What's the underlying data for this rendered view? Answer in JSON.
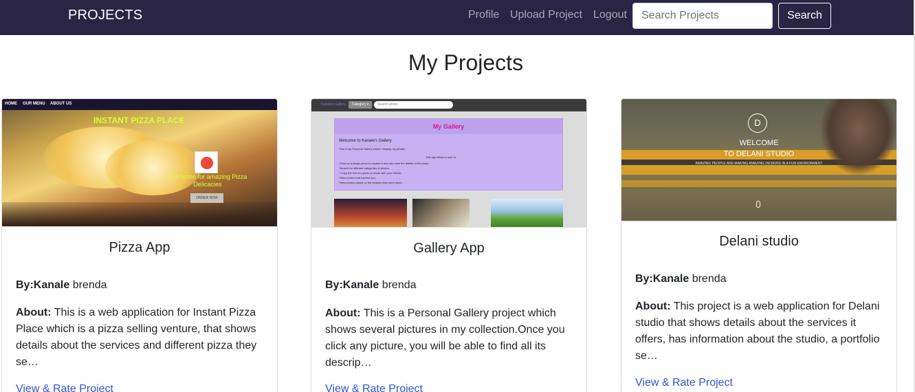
{
  "navbar": {
    "brand": "PROJECTS",
    "links": {
      "profile": "Profile",
      "upload": "Upload Project",
      "logout": "Logout"
    },
    "search": {
      "placeholder": "Search Projects",
      "value": "",
      "button": "Search"
    },
    "background": "#2a2545"
  },
  "page": {
    "title": "My Projects"
  },
  "cards": [
    {
      "title": "Pizza App",
      "by_label": "By:",
      "author_first": "Kanale",
      "author_last": " brenda",
      "about_label": "About:",
      "about": " This is a web application for Instant Pizza Place which is a pizza selling venture, that shows details about the services and different pizza they se…",
      "link": "View & Rate Project",
      "thumbnail": {
        "menu": [
          "HOME",
          "OUR MENU",
          "ABOUT US"
        ],
        "heading": "INSTANT PIZZA PLACE",
        "tagline": "The home for amazing Pizza Delicacies",
        "button": "ORDER NOW"
      }
    },
    {
      "title": "Gallery App",
      "by_label": "By:",
      "author_first": "Kanale",
      "author_last": " brenda",
      "about_label": "About:",
      "about": " This is a Personal Gallery project which shows several pictures in my collection.Once you click any picture, you will be able to find all its descrip…",
      "link": "View & Rate Project",
      "thumbnail": {
        "brand": "Kanale's Gallery",
        "category": "Category ▾",
        "search": "Search photo",
        "heading": "My Gallery",
        "welcome": "Welcome to Kanale's Gallery",
        "lines": [
          "This is my Personal Gallery where I display my photos.",
          "This app allows a user to:",
          "*Click on a single photo to expand it and also view the details of the photo.",
          "*Search for different categories of photos.",
          "* Copy the link of a photo to share with your friends.",
          "*View photos that interest you.",
          "*View photos based on the location they were taken."
        ]
      }
    },
    {
      "title": "Delani studio",
      "by_label": "By:",
      "author_first": "Kanale",
      "author_last": " brenda",
      "about_label": "About:",
      "about": " This project is a web application for Delani studio that shows details about the services it offers, has information about the studio, a portfolio se…",
      "link": "View & Rate Project",
      "thumbnail": {
        "logo": "D",
        "welcome_1": "WELCOME",
        "welcome_2": "TO DELANI STUDIO",
        "subtitle": "AMAZING PEOPLE ARE MAKING AMAZING DESIGNS IN A FUN ENVIRONMENT"
      }
    }
  ],
  "colors": {
    "link": "#2f55d4",
    "accent_yellow": "#e6a521",
    "gallery_panel": "#c7b1f2"
  },
  "icons": [
    "scroll-mouse-icon"
  ]
}
